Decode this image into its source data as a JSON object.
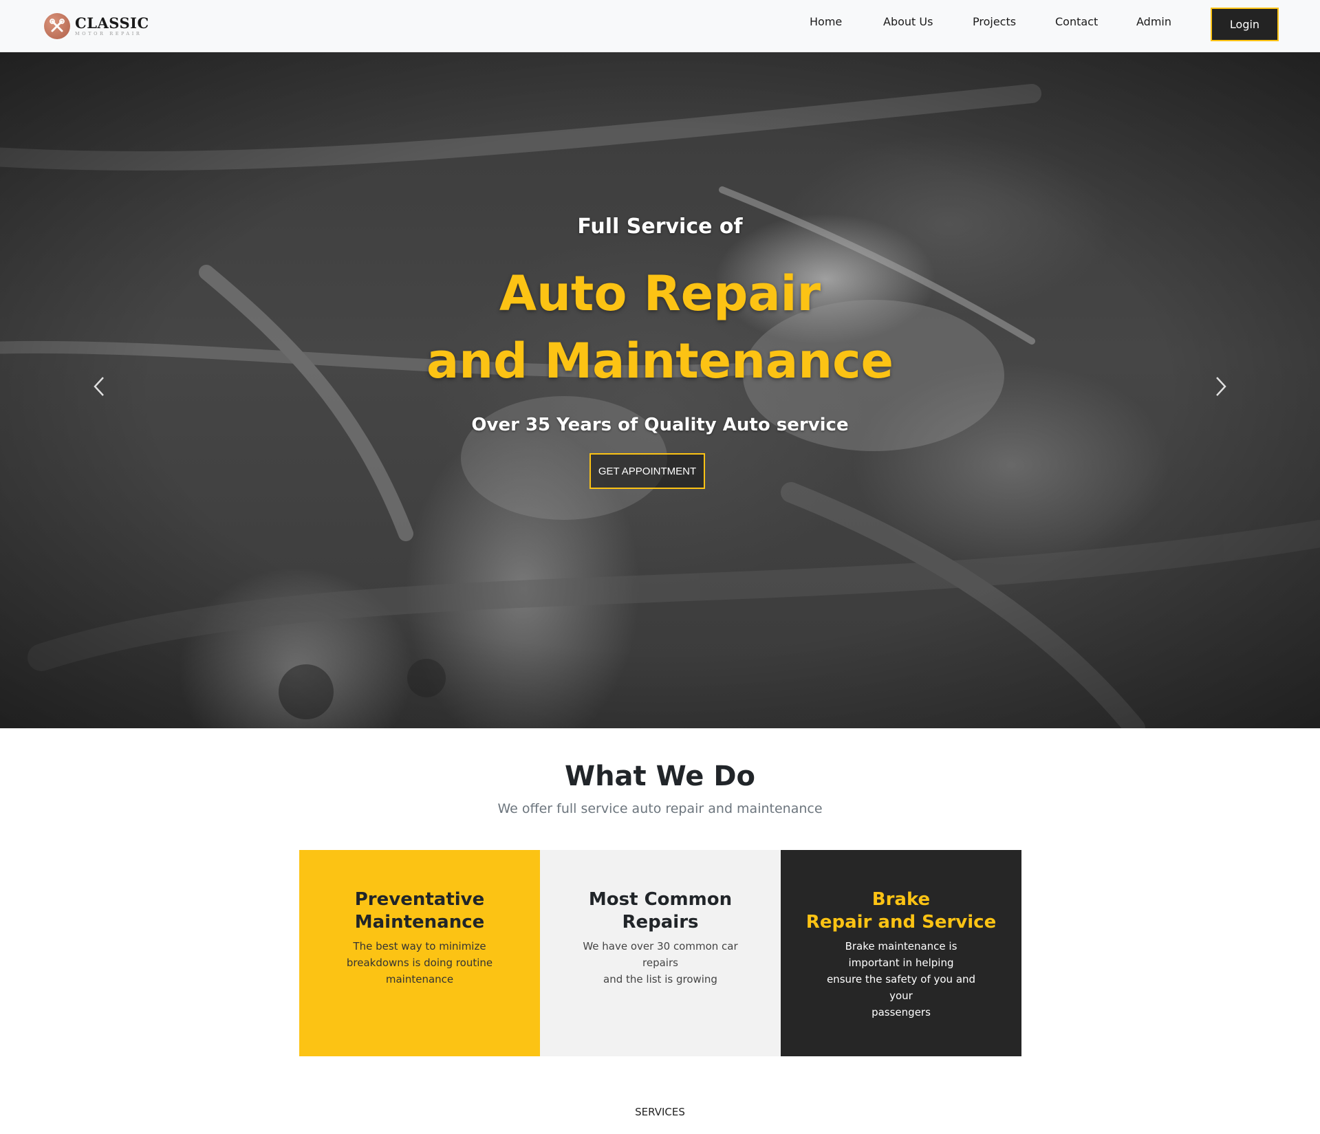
{
  "brand": {
    "name": "CLASSIC",
    "tagline": "MOTOR REPAIR"
  },
  "nav": {
    "links": [
      "Home",
      "About Us",
      "Projects",
      "Contact",
      "Admin"
    ],
    "login_label": "Login"
  },
  "hero": {
    "pre_title": "Full Service of",
    "title_line1": "Auto Repair",
    "title_line2": "and Maintenance",
    "subtitle": "Over 35 Years of Quality Auto service",
    "cta_label": "GET APPOINTMENT",
    "prev_icon": "chevron-left-icon",
    "next_icon": "chevron-right-icon"
  },
  "what_we_do": {
    "title": "What We Do",
    "subtitle": "We offer full service auto repair and maintenance",
    "cards": [
      {
        "title": "Preventative\nMaintenance",
        "text": "The best way to minimize\nbreakdowns is doing routine\nmaintenance"
      },
      {
        "title": "Most Common\nRepairs",
        "text": "We have over 30 common car\nrepairs\nand the list is growing"
      },
      {
        "title": "Brake\nRepair and Service",
        "text": "Brake maintenance is\nimportant in helping\nensure the safety of you and\nyour\npassengers"
      }
    ]
  },
  "services_label": "SERVICES",
  "colors": {
    "accent": "#fcc314",
    "dark": "#262626",
    "light": "#f2f2f2",
    "navbar_bg": "#f8f9fa"
  }
}
